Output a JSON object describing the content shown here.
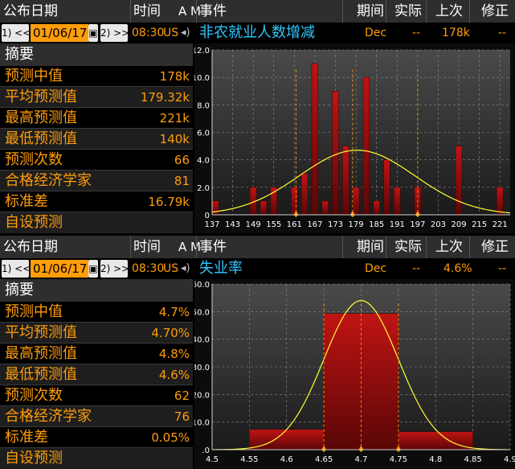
{
  "colors": {
    "accent": "#ff9d0a",
    "event": "#2fc7ff",
    "bar": "#a01010",
    "curve": "#ffff33"
  },
  "headers": {
    "release_date": "公布日期",
    "time": "时间",
    "am": "A M",
    "event": "事件",
    "period": "期间",
    "actual": "实际",
    "prior": "上次",
    "revision": "修正"
  },
  "nav": {
    "prev_label": "1) <<",
    "cal_icon": "calendar-icon",
    "next_label": "2) >>",
    "speaker_icon": "speaker-icon"
  },
  "panels": [
    {
      "date": "01/06/17",
      "time": "08:30",
      "country": "US",
      "event": "非农就业人数增减",
      "period": "Dec",
      "actual": "--",
      "prior": "178k",
      "revision": "--",
      "summary_title": "摘要",
      "summary": [
        {
          "label": "预测中值",
          "value": "178k"
        },
        {
          "label": "平均预测值",
          "value": "179.32k"
        },
        {
          "label": "最高预测值",
          "value": "221k"
        },
        {
          "label": "最低预测值",
          "value": "140k"
        },
        {
          "label": "预测次数",
          "value": "66"
        },
        {
          "label": "合格经济学家",
          "value": "81"
        },
        {
          "label": "标准差",
          "value": "16.79k"
        },
        {
          "label": "自设预测",
          "value": ""
        }
      ]
    },
    {
      "date": "01/06/17",
      "time": "08:30",
      "country": "US",
      "event": "失业率",
      "period": "Dec",
      "actual": "--",
      "prior": "4.6%",
      "revision": "--",
      "summary_title": "摘要",
      "summary": [
        {
          "label": "预测中值",
          "value": "4.7%"
        },
        {
          "label": "平均预测值",
          "value": "4.70%"
        },
        {
          "label": "最高预测值",
          "value": "4.8%"
        },
        {
          "label": "最低预测值",
          "value": "4.6%"
        },
        {
          "label": "预测次数",
          "value": "62"
        },
        {
          "label": "合格经济学家",
          "value": "76"
        },
        {
          "label": "标准差",
          "value": "0.05%"
        },
        {
          "label": "自设预测",
          "value": ""
        }
      ]
    }
  ],
  "chart_data": [
    {
      "type": "bar",
      "x": [
        138,
        140,
        143,
        146,
        149,
        152,
        155,
        158,
        161,
        164,
        167,
        170,
        173,
        176,
        179,
        182,
        185,
        188,
        191,
        194,
        197,
        200,
        203,
        206,
        209,
        212,
        215,
        218,
        221
      ],
      "values": [
        1,
        0,
        0,
        0,
        2,
        1,
        2,
        0,
        2,
        3,
        11,
        1,
        9,
        5,
        2,
        10,
        1,
        4,
        2,
        0,
        2,
        0,
        0,
        0,
        5,
        0,
        0,
        0,
        2
      ],
      "xticks": [
        137,
        143,
        149,
        155,
        161,
        167,
        173,
        179,
        185,
        191,
        197,
        203,
        209,
        215,
        221
      ],
      "yticks": [
        "0",
        "2.0",
        "4.0",
        "6.0",
        "8.0",
        "10.0",
        "12.0"
      ],
      "xlim": [
        137,
        224
      ],
      "ylim": [
        0,
        12
      ],
      "curve": {
        "mean": 179.32,
        "sd": 16.79,
        "peak": 4.7
      },
      "markers": [
        161.5,
        178,
        197
      ],
      "grid": true
    },
    {
      "type": "bar",
      "x": [
        4.6,
        4.7,
        4.8
      ],
      "values": [
        7.3,
        49.3,
        6.5
      ],
      "bar_width": 0.1,
      "xticks": [
        "4.5",
        "4.55",
        "4.6",
        "4.65",
        "4.7",
        "4.75",
        "4.8",
        "4.85",
        "4.9"
      ],
      "yticks": [
        ".0",
        "10.0",
        "20.0",
        "30.0",
        "40.0",
        "50.0",
        "60.0"
      ],
      "xlim": [
        4.5,
        4.9
      ],
      "ylim": [
        0,
        60
      ],
      "curve": {
        "mean": 4.7,
        "sd": 0.05,
        "peak": 54
      },
      "markers": [
        4.65,
        4.7,
        4.75
      ],
      "grid": true
    }
  ]
}
